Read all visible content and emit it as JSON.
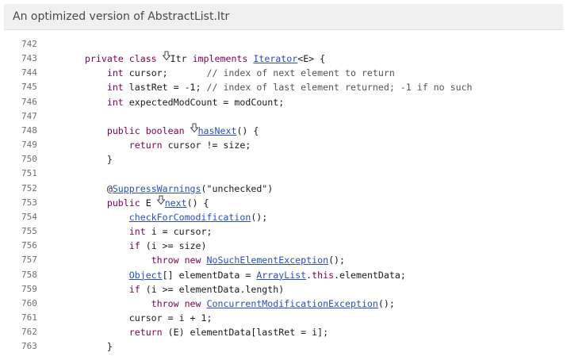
{
  "window": {
    "title": "An optimized version of AbstractList.Itr"
  },
  "code": {
    "lines": [
      {
        "n": "742",
        "parts": []
      },
      {
        "n": "743",
        "parts": [
          {
            "t": "    "
          },
          {
            "t": "private class",
            "c": "kw"
          },
          {
            "t": " "
          },
          {
            "icon": "override-marker-icon"
          },
          {
            "t": "Itr "
          },
          {
            "t": "implements",
            "c": "kw"
          },
          {
            "t": " "
          },
          {
            "t": "Iterator",
            "c": "lk",
            "link": true
          },
          {
            "t": "<E> {"
          }
        ]
      },
      {
        "n": "744",
        "parts": [
          {
            "t": "        "
          },
          {
            "t": "int",
            "c": "kw"
          },
          {
            "t": " cursor;       "
          },
          {
            "t": "// index of next element to return",
            "c": "cm"
          }
        ]
      },
      {
        "n": "745",
        "parts": [
          {
            "t": "        "
          },
          {
            "t": "int",
            "c": "kw"
          },
          {
            "t": " lastRet = -1; "
          },
          {
            "t": "// index of last element returned; -1 if no such",
            "c": "cm"
          }
        ]
      },
      {
        "n": "746",
        "parts": [
          {
            "t": "        "
          },
          {
            "t": "int",
            "c": "kw"
          },
          {
            "t": " expectedModCount = modCount;"
          }
        ]
      },
      {
        "n": "747",
        "parts": []
      },
      {
        "n": "748",
        "parts": [
          {
            "t": "        "
          },
          {
            "t": "public boolean",
            "c": "kw"
          },
          {
            "t": " "
          },
          {
            "icon": "override-marker-icon"
          },
          {
            "t": "hasNext",
            "c": "lk",
            "link": true
          },
          {
            "t": "() {"
          }
        ]
      },
      {
        "n": "749",
        "parts": [
          {
            "t": "            "
          },
          {
            "t": "return",
            "c": "kw"
          },
          {
            "t": " cursor != size;"
          }
        ]
      },
      {
        "n": "750",
        "parts": [
          {
            "t": "        }"
          }
        ]
      },
      {
        "n": "751",
        "parts": []
      },
      {
        "n": "752",
        "parts": [
          {
            "t": "        @"
          },
          {
            "t": "SuppressWarnings",
            "c": "lk",
            "link": true
          },
          {
            "t": "(\"unchecked\")",
            "c": "st"
          }
        ]
      },
      {
        "n": "753",
        "parts": [
          {
            "t": "        "
          },
          {
            "t": "public",
            "c": "kw"
          },
          {
            "t": " E "
          },
          {
            "icon": "override-marker-icon"
          },
          {
            "t": "next",
            "c": "lk",
            "link": true
          },
          {
            "t": "() {"
          }
        ]
      },
      {
        "n": "754",
        "parts": [
          {
            "t": "            "
          },
          {
            "t": "checkForComodification",
            "c": "lk",
            "link": true
          },
          {
            "t": "();"
          }
        ]
      },
      {
        "n": "755",
        "parts": [
          {
            "t": "            "
          },
          {
            "t": "int",
            "c": "kw"
          },
          {
            "t": " i = cursor;"
          }
        ]
      },
      {
        "n": "756",
        "parts": [
          {
            "t": "            "
          },
          {
            "t": "if",
            "c": "kw"
          },
          {
            "t": " (i >= size)"
          }
        ]
      },
      {
        "n": "757",
        "parts": [
          {
            "t": "                "
          },
          {
            "t": "throw new",
            "c": "kw"
          },
          {
            "t": " "
          },
          {
            "t": "NoSuchElementException",
            "c": "lk",
            "link": true
          },
          {
            "t": "();"
          }
        ]
      },
      {
        "n": "758",
        "parts": [
          {
            "t": "            "
          },
          {
            "t": "Object",
            "c": "lk",
            "link": true
          },
          {
            "t": "[] elementData = "
          },
          {
            "t": "ArrayList",
            "c": "lk",
            "link": true
          },
          {
            "t": "."
          },
          {
            "t": "this",
            "c": "kw"
          },
          {
            "t": ".elementData;"
          }
        ]
      },
      {
        "n": "759",
        "parts": [
          {
            "t": "            "
          },
          {
            "t": "if",
            "c": "kw"
          },
          {
            "t": " (i >= elementData.length)"
          }
        ]
      },
      {
        "n": "760",
        "parts": [
          {
            "t": "                "
          },
          {
            "t": "throw new",
            "c": "kw"
          },
          {
            "t": " "
          },
          {
            "t": "ConcurrentModificationException",
            "c": "lk",
            "link": true
          },
          {
            "t": "();"
          }
        ]
      },
      {
        "n": "761",
        "parts": [
          {
            "t": "            cursor = i + 1;"
          }
        ]
      },
      {
        "n": "762",
        "parts": [
          {
            "t": "            "
          },
          {
            "t": "return",
            "c": "kw"
          },
          {
            "t": " (E) elementData[lastRet = i];"
          }
        ]
      },
      {
        "n": "763",
        "parts": [
          {
            "t": "        }"
          }
        ]
      }
    ]
  }
}
